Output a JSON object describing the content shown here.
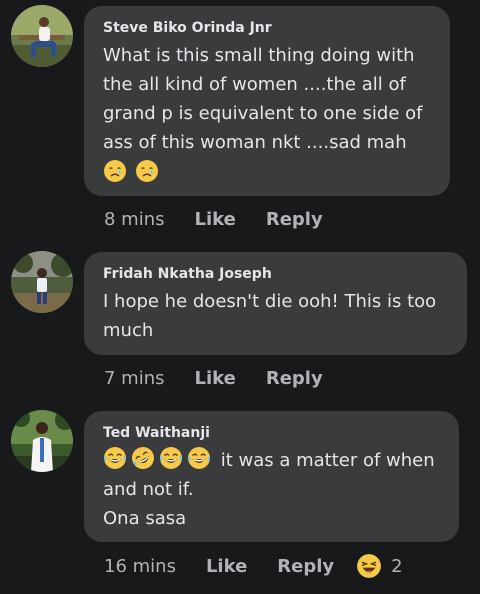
{
  "comments": [
    {
      "author": "Steve Biko Orinda Jnr",
      "text": "What is this small thing doing with\nthe all kind of women ....the all of\ngrand p is equivalent to one side of\nass of this woman nkt ....sad mah",
      "emojis": [
        "crying-face-icon",
        "crying-face-icon"
      ],
      "time": "8 mins",
      "like_label": "Like",
      "reply_label": "Reply"
    },
    {
      "author": "Fridah Nkatha Joseph",
      "text": "I hope he doesn't die ooh! This is too\nmuch",
      "time": "7 mins",
      "like_label": "Like",
      "reply_label": "Reply"
    },
    {
      "author": "Ted Waithanji",
      "emojis": [
        "tears-of-joy-icon",
        "rolling-laughing-icon",
        "tears-of-joy-icon",
        "tears-of-joy-icon"
      ],
      "text_after_emojis": " it was a matter of when",
      "text": "and not if.\nOna sasa",
      "time": "16 mins",
      "like_label": "Like",
      "reply_label": "Reply",
      "reaction_icon": "laughing-reaction-icon",
      "reaction_count": "2"
    }
  ],
  "colors": {
    "background": "#18191a",
    "bubble": "#3a3b3c",
    "primary_text": "#e4e6eb",
    "secondary_text": "#b0b3b8",
    "emoji_yellow": "#f7c948"
  }
}
